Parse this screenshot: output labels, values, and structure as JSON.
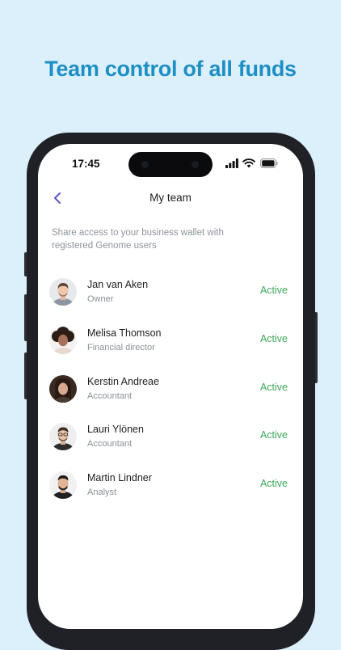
{
  "headline": "Team control of all funds",
  "status_bar": {
    "time": "17:45"
  },
  "nav": {
    "title": "My team"
  },
  "description": "Share access to your business wallet with registered Genome users",
  "members": [
    {
      "name": "Jan van Aken",
      "role": "Owner",
      "status": "Active"
    },
    {
      "name": "Melisa Thomson",
      "role": "Financial director",
      "status": "Active"
    },
    {
      "name": "Kerstin Andreae",
      "role": "Accountant",
      "status": "Active"
    },
    {
      "name": "Lauri Ylönen",
      "role": "Accountant",
      "status": "Active"
    },
    {
      "name": "Martin Lindner",
      "role": "Analyst",
      "status": "Active"
    }
  ],
  "colors": {
    "background": "#dcf0fb",
    "headline": "#1d8fc4",
    "accent": "#5b54c9",
    "status_active": "#3ea85b"
  },
  "icons": {
    "back": "chevron-left-icon",
    "signal": "signal-icon",
    "wifi": "wifi-icon",
    "battery": "battery-icon"
  }
}
